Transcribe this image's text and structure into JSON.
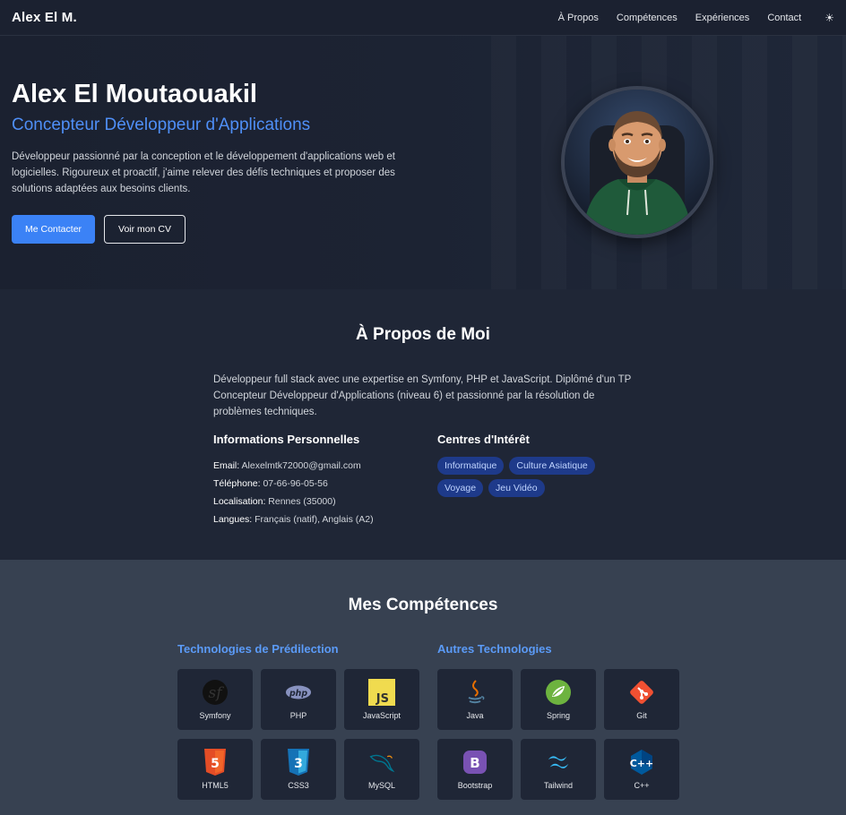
{
  "nav": {
    "brand": "Alex El M.",
    "links": [
      "À Propos",
      "Compétences",
      "Expériences",
      "Contact"
    ],
    "theme_icon": "☀"
  },
  "hero": {
    "name": "Alex El Moutaouakil",
    "role": "Concepteur Développeur d'Applications",
    "description": "Développeur passionné par la conception et le développement d'applications web et logicielles. Rigoureux et proactif, j'aime relever des défis techniques et proposer des solutions adaptées aux besoins clients.",
    "contact_button": "Me Contacter",
    "cv_button": "Voir mon CV"
  },
  "about": {
    "title": "À Propos de Moi",
    "text": "Développeur full stack avec une expertise en Symfony, PHP et JavaScript. Diplômé d'un TP Concepteur Développeur d'Applications (niveau 6) et passionné par la résolution de problèmes techniques.",
    "info_title": "Informations Personnelles",
    "info": [
      {
        "label": "Email:",
        "value": "Alexelmtk72000@gmail.com"
      },
      {
        "label": "Téléphone:",
        "value": "07-66-96-05-56"
      },
      {
        "label": "Localisation:",
        "value": "Rennes (35000)"
      },
      {
        "label": "Langues:",
        "value": "Français (natif), Anglais (A2)"
      }
    ],
    "interests_title": "Centres d'Intérêt",
    "interests": [
      "Informatique",
      "Culture Asiatique",
      "Voyage",
      "Jeu Vidéo"
    ]
  },
  "skills": {
    "title": "Mes Compétences",
    "preferred_title": "Technologies de Prédilection",
    "preferred": [
      {
        "label": "Symfony",
        "icon": "symfony-icon"
      },
      {
        "label": "PHP",
        "icon": "php-icon"
      },
      {
        "label": "JavaScript",
        "icon": "javascript-icon"
      },
      {
        "label": "HTML5",
        "icon": "html5-icon"
      },
      {
        "label": "CSS3",
        "icon": "css3-icon"
      },
      {
        "label": "MySQL",
        "icon": "mysql-icon"
      }
    ],
    "others_title": "Autres Technologies",
    "others": [
      {
        "label": "Java",
        "icon": "java-icon"
      },
      {
        "label": "Spring",
        "icon": "spring-icon"
      },
      {
        "label": "Git",
        "icon": "git-icon"
      },
      {
        "label": "Bootstrap",
        "icon": "bootstrap-icon"
      },
      {
        "label": "Tailwind",
        "icon": "tailwind-icon"
      },
      {
        "label": "C++",
        "icon": "cpp-icon"
      }
    ]
  },
  "colors": {
    "accent": "#3b82f6",
    "background": "#1e2533",
    "skills_background": "#374151"
  }
}
